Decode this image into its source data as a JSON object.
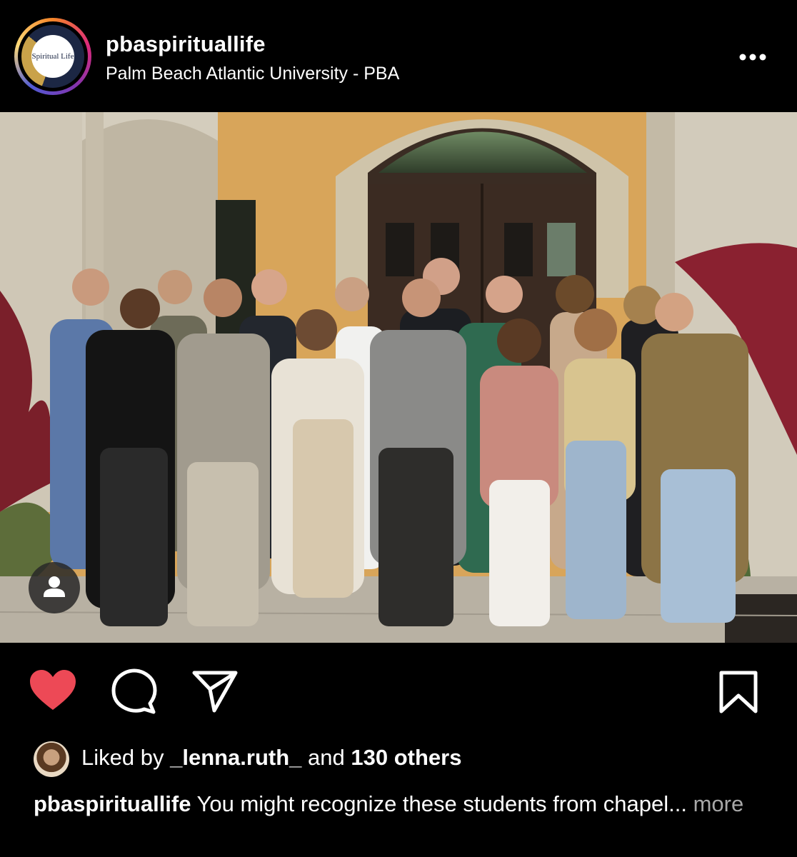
{
  "post": {
    "username": "pbaspirituallife",
    "location": "Palm Beach Atlantic University - PBA",
    "avatar_text": "Spiritual Life",
    "likes": {
      "prefix": "Liked by",
      "user": "_lenna.ruth_",
      "connector": "and",
      "others": "130 others"
    },
    "caption": {
      "user": "pbaspirituallife",
      "text": "You might recognize these students from chapel...",
      "more": "more"
    }
  },
  "icons": {
    "like": "heart-filled-icon",
    "comment": "comment-icon",
    "share": "send-icon",
    "save": "bookmark-icon",
    "more": "more-dots-icon",
    "tag": "user-tag-icon"
  },
  "colors": {
    "background": "#000000",
    "like": "#ed4956",
    "muted": "#a8a8a8"
  }
}
